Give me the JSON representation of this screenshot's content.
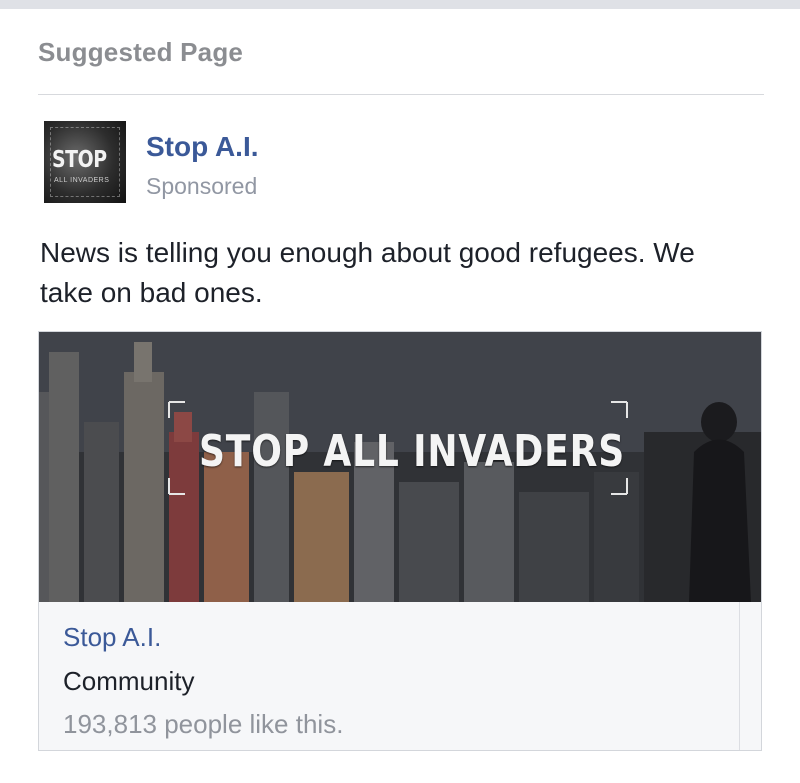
{
  "section": {
    "title": "Suggested Page"
  },
  "post": {
    "author": "Stop A.I.",
    "label": "Sponsored",
    "text": "News is telling you enough about good refugees. We take on bad ones.",
    "avatar_text": "STOP",
    "avatar_subtext": "ALL INVADERS"
  },
  "attachment": {
    "image_headline": "STOP ALL INVADERS",
    "page_name": "Stop A.I.",
    "category": "Community",
    "likes": "193,813 people like this."
  },
  "colors": {
    "link_blue": "#3b5998",
    "muted_gray": "#9197a3",
    "text_dark": "#1d2129"
  }
}
